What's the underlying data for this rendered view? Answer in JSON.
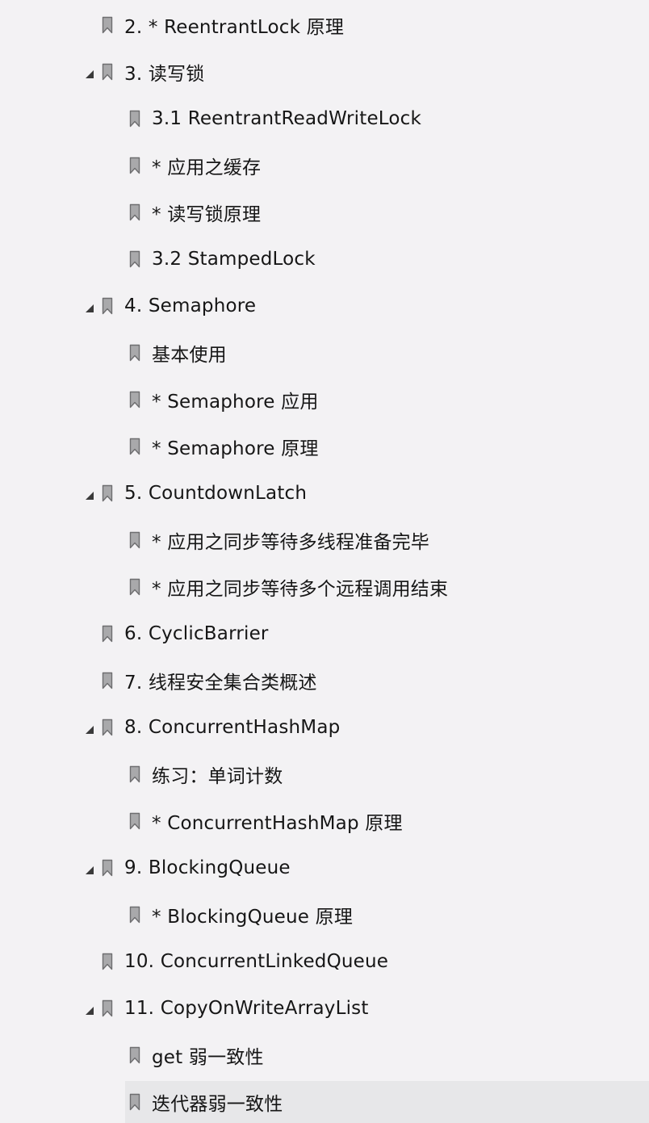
{
  "colors": {
    "background": "#f3f2f4",
    "selected_row": "#e7e7e9",
    "bookmark_fill": "#a9a9ab",
    "bookmark_stroke": "#6e6e70",
    "text": "#161616"
  },
  "bookmarks": [
    {
      "label": "2. * ReentrantLock 原理",
      "level": 1,
      "expandable": false,
      "expanded": false
    },
    {
      "label": "3. 读写锁",
      "level": 1,
      "expandable": true,
      "expanded": true
    },
    {
      "label": "3.1 ReentrantReadWriteLock",
      "level": 2,
      "expandable": false,
      "expanded": false
    },
    {
      "label": "* 应用之缓存",
      "level": 2,
      "expandable": false,
      "expanded": false
    },
    {
      "label": "* 读写锁原理",
      "level": 2,
      "expandable": false,
      "expanded": false
    },
    {
      "label": "3.2 StampedLock",
      "level": 2,
      "expandable": false,
      "expanded": false
    },
    {
      "label": "4. Semaphore",
      "level": 1,
      "expandable": true,
      "expanded": true
    },
    {
      "label": "基本使用",
      "level": 2,
      "expandable": false,
      "expanded": false
    },
    {
      "label": "* Semaphore 应用",
      "level": 2,
      "expandable": false,
      "expanded": false
    },
    {
      "label": "* Semaphore 原理",
      "level": 2,
      "expandable": false,
      "expanded": false
    },
    {
      "label": "5. CountdownLatch",
      "level": 1,
      "expandable": true,
      "expanded": true
    },
    {
      "label": "* 应用之同步等待多线程准备完毕",
      "level": 2,
      "expandable": false,
      "expanded": false
    },
    {
      "label": "* 应用之同步等待多个远程调用结束",
      "level": 2,
      "expandable": false,
      "expanded": false
    },
    {
      "label": "6. CyclicBarrier",
      "level": 1,
      "expandable": false,
      "expanded": false
    },
    {
      "label": "7. 线程安全集合类概述",
      "level": 1,
      "expandable": false,
      "expanded": false
    },
    {
      "label": "8. ConcurrentHashMap",
      "level": 1,
      "expandable": true,
      "expanded": true
    },
    {
      "label": "练习：单词计数",
      "level": 2,
      "expandable": false,
      "expanded": false
    },
    {
      "label": "* ConcurrentHashMap 原理",
      "level": 2,
      "expandable": false,
      "expanded": false
    },
    {
      "label": "9. BlockingQueue",
      "level": 1,
      "expandable": true,
      "expanded": true
    },
    {
      "label": "* BlockingQueue 原理",
      "level": 2,
      "expandable": false,
      "expanded": false
    },
    {
      "label": "10. ConcurrentLinkedQueue",
      "level": 1,
      "expandable": false,
      "expanded": false
    },
    {
      "label": "11. CopyOnWriteArrayList",
      "level": 1,
      "expandable": true,
      "expanded": true
    },
    {
      "label": "get 弱一致性",
      "level": 2,
      "expandable": false,
      "expanded": false
    },
    {
      "label": "迭代器弱一致性",
      "level": 2,
      "expandable": false,
      "expanded": false,
      "selected": true
    }
  ]
}
